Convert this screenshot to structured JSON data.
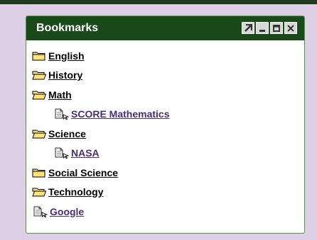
{
  "panel": {
    "title": "Bookmarks",
    "buttons": {
      "popout": "popout",
      "minimize": "minimize",
      "maximize": "maximize",
      "close": "close"
    }
  },
  "bookmarks": {
    "english": "English",
    "history": "History",
    "math": "Math",
    "score_math": "SCORE Mathematics",
    "science": "Science",
    "nasa": "NASA",
    "social_science": "Social Science",
    "technology": "Technology",
    "google": "Google"
  },
  "colors": {
    "titlebar": "#1a4a1a",
    "border": "#4e9a34",
    "folder": "#ffe27a",
    "link_text": "#4a2c7a",
    "background": "#ddd0e6"
  }
}
